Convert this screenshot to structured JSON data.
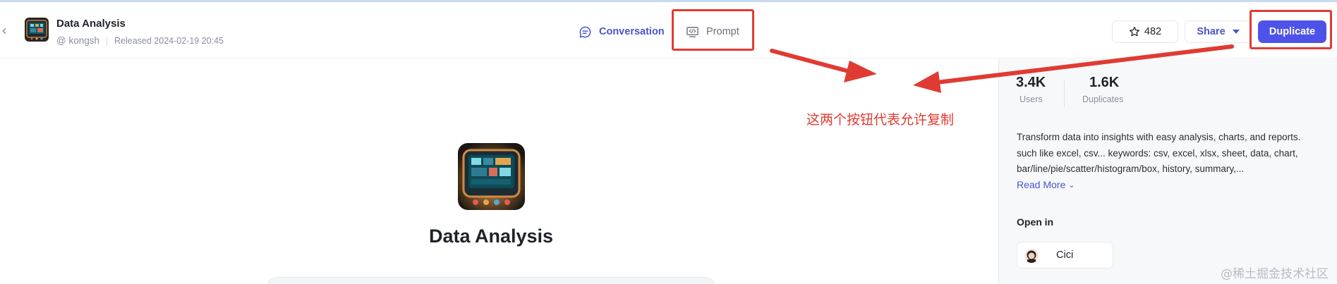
{
  "header": {
    "app_title": "Data Analysis",
    "author": "@ kongsh",
    "released": "Released 2024-02-19 20:45",
    "tabs": [
      {
        "label": "Conversation",
        "icon": "chat-bubble-icon"
      },
      {
        "label": "Prompt",
        "icon": "code-monitor-icon"
      }
    ],
    "star_count": "482",
    "share_label": "Share",
    "duplicate_label": "Duplicate"
  },
  "main": {
    "title": "Data Analysis"
  },
  "sidebar": {
    "stats": [
      {
        "value": "3.4K",
        "label": "Users"
      },
      {
        "value": "1.6K",
        "label": "Duplicates"
      }
    ],
    "description": "Transform data into insights with easy analysis, charts, and reports. such like excel, csv... keywords: csv, excel, xlsx, sheet, data, chart, bar/line/pie/scatter/histogram/box, history, summary,...",
    "read_more": "Read More",
    "open_in_title": "Open in",
    "open_in_app": "Cici"
  },
  "annotation": {
    "text": "这两个按钮代表允许复制"
  },
  "watermark": "@稀土掘金技术社区",
  "colors": {
    "accent": "#4d53e8",
    "link": "#4a55c9",
    "annotation_red": "#e03b32"
  }
}
